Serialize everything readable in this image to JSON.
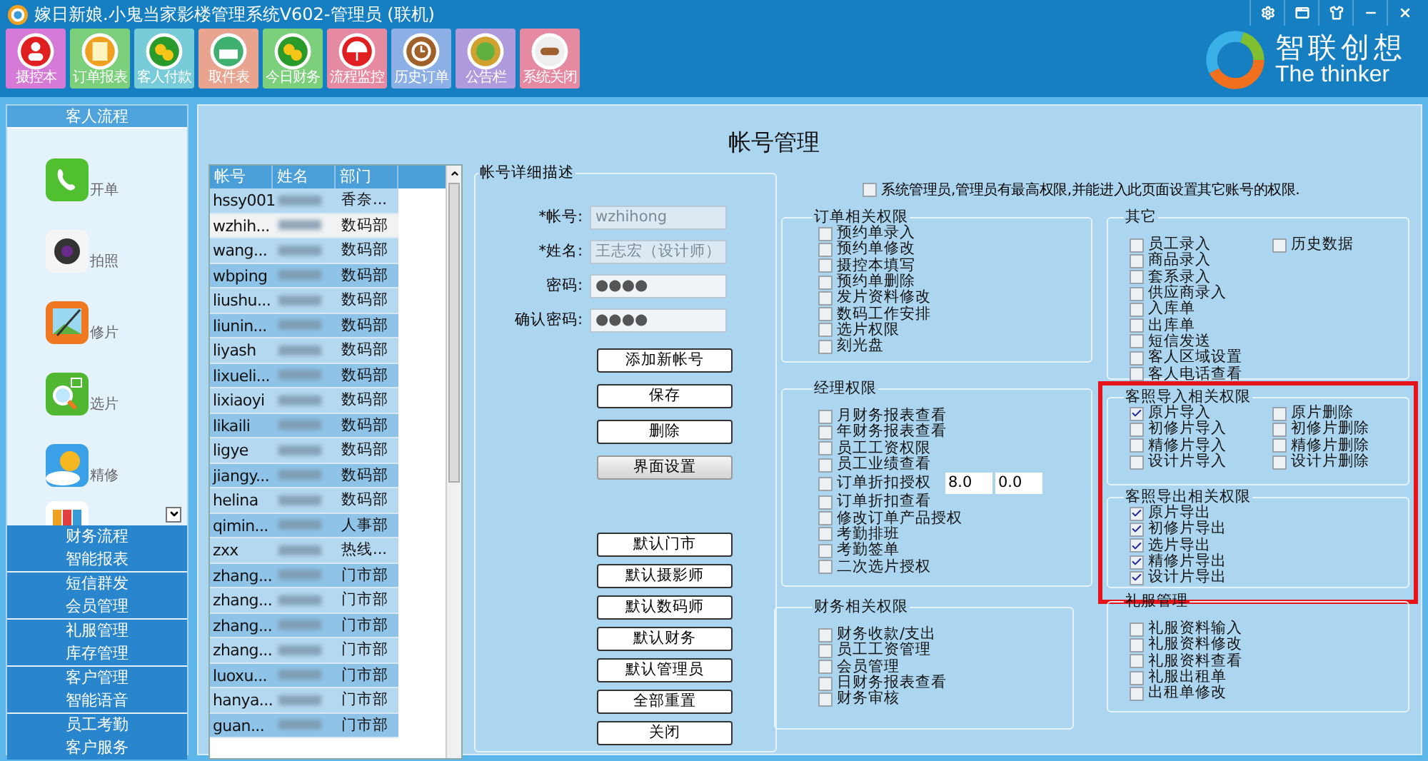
{
  "window": {
    "title": "嫁日新娘.小鬼当家影楼管理系统V602-管理员 (联机)"
  },
  "toolbar": [
    {
      "label": "摄控本",
      "color": "#d57ad6"
    },
    {
      "label": "订单报表",
      "color": "#7cd07c"
    },
    {
      "label": "客人付款",
      "color": "#78cbd8"
    },
    {
      "label": "取件表",
      "color": "#e9a48f"
    },
    {
      "label": "今日财务",
      "color": "#7cd07c"
    },
    {
      "label": "流程监控",
      "color": "#e68aa2"
    },
    {
      "label": "历史订单",
      "color": "#8cb0e6"
    },
    {
      "label": "公告栏",
      "color": "#b09ade"
    },
    {
      "label": "系统关闭",
      "color": "#e68aa2"
    }
  ],
  "logo": {
    "name": "智联创想",
    "tagline": "The thinker"
  },
  "sidebar": {
    "sections": [
      {
        "label": "客人流程",
        "expanded": true,
        "items": [
          "开单",
          "拍照",
          "修片",
          "选片",
          "精修"
        ]
      },
      {
        "label": "财务流程",
        "expanded": false
      },
      {
        "label": "智能报表",
        "expanded": false
      },
      {
        "label": "短信群发",
        "expanded": false
      },
      {
        "label": "会员管理",
        "expanded": false
      },
      {
        "label": "礼服管理",
        "expanded": false
      },
      {
        "label": "库存管理",
        "expanded": false
      },
      {
        "label": "客户管理",
        "expanded": false
      },
      {
        "label": "智能语音",
        "expanded": false
      },
      {
        "label": "员工考勤",
        "expanded": false
      },
      {
        "label": "客户服务",
        "expanded": false
      }
    ]
  },
  "page_title": "帐号管理",
  "accounts_table": {
    "columns": [
      "帐号",
      "姓名",
      "部门"
    ],
    "rows": [
      {
        "account": "hssy001",
        "department": "香奈...",
        "selected": false
      },
      {
        "account": "wzhih...",
        "department": "数码部",
        "selected": true
      },
      {
        "account": "wang...",
        "department": "数码部",
        "selected": false
      },
      {
        "account": "wbping",
        "department": "数码部",
        "selected": false
      },
      {
        "account": "liushu...",
        "department": "数码部",
        "selected": false
      },
      {
        "account": "liunin...",
        "department": "数码部",
        "selected": false
      },
      {
        "account": "liyash",
        "department": "数码部",
        "selected": false
      },
      {
        "account": "lixueli...",
        "department": "数码部",
        "selected": false
      },
      {
        "account": "lixiaoyi",
        "department": "数码部",
        "selected": false
      },
      {
        "account": "likaili",
        "department": "数码部",
        "selected": false
      },
      {
        "account": "ligye",
        "department": "数码部",
        "selected": false
      },
      {
        "account": "jiangy...",
        "department": "数码部",
        "selected": false
      },
      {
        "account": "helina",
        "department": "数码部",
        "selected": false
      },
      {
        "account": "qimin...",
        "department": "人事部",
        "selected": false
      },
      {
        "account": "zxx",
        "department": "热线...",
        "selected": false
      },
      {
        "account": "zhang...",
        "department": "门市部",
        "selected": false
      },
      {
        "account": "zhang...",
        "department": "门市部",
        "selected": false
      },
      {
        "account": "zhang...",
        "department": "门市部",
        "selected": false
      },
      {
        "account": "zhang...",
        "department": "门市部",
        "selected": false
      },
      {
        "account": "luoxu...",
        "department": "门市部",
        "selected": false
      },
      {
        "account": "hanya...",
        "department": "门市部",
        "selected": false
      },
      {
        "account": "guan...",
        "department": "门市部",
        "selected": false
      }
    ]
  },
  "account_details": {
    "title": "帐号详细描述",
    "fields": [
      {
        "label": "*帐号:",
        "value": "wzhihong",
        "kind": "text",
        "disabled": true
      },
      {
        "label": "*姓名:",
        "value": "王志宏（设计师）",
        "kind": "select",
        "disabled": true
      },
      {
        "label": "密码:",
        "value": "●●●●",
        "kind": "text",
        "disabled": false
      },
      {
        "label": "确认密码:",
        "value": "●●●●",
        "kind": "text",
        "disabled": false
      }
    ],
    "buttons": [
      {
        "label": "添加新帐号",
        "kind": "plain"
      },
      {
        "label": "保存",
        "kind": "plain"
      },
      {
        "label": "删除",
        "kind": "plain"
      },
      {
        "label": "界面设置",
        "kind": "shaded"
      }
    ],
    "default_buttons": [
      "默认门市",
      "默认摄影师",
      "默认数码师",
      "默认财务",
      "默认管理员",
      "全部重置",
      "关闭"
    ]
  },
  "system_admin": {
    "label": "系统管理员,管理员有最高权限,并能进入此页面设置其它账号的权限.",
    "checked": false
  },
  "left_groups": [
    {
      "title": "订单相关权限",
      "columns": [
        [
          {
            "label": "预约单录入",
            "checked": false
          },
          {
            "label": "预约单修改",
            "checked": false
          },
          {
            "label": "摄控本填写",
            "checked": false
          },
          {
            "label": "预约单删除",
            "checked": false
          },
          {
            "label": "发片资料修改",
            "checked": false
          },
          {
            "label": "数码工作安排",
            "checked": false
          },
          {
            "label": "选片权限",
            "checked": false
          },
          {
            "label": "刻光盘",
            "checked": false
          }
        ]
      ]
    },
    {
      "title": "经理权限",
      "discount_fields": [
        "8.0",
        "0.0"
      ],
      "columns": [
        [
          {
            "label": "月财务报表查看",
            "checked": false
          },
          {
            "label": "年财务报表查看",
            "checked": false
          },
          {
            "label": "员工工资权限",
            "checked": false
          },
          {
            "label": "员工业绩查看",
            "checked": false
          },
          {
            "label": "订单折扣授权",
            "checked": false
          },
          {
            "label": "订单折扣查看",
            "checked": false
          },
          {
            "label": "修改订单产品授权",
            "checked": false
          },
          {
            "label": "考勤排班",
            "checked": false
          },
          {
            "label": "考勤签单",
            "checked": false
          },
          {
            "label": "二次选片授权",
            "checked": false
          }
        ]
      ]
    },
    {
      "title": "财务相关权限",
      "columns": [
        [
          {
            "label": "财务收款/支出",
            "checked": false
          },
          {
            "label": "员工工资管理",
            "checked": false
          },
          {
            "label": "会员管理",
            "checked": false
          },
          {
            "label": "日财务报表查看",
            "checked": false
          },
          {
            "label": "财务审核",
            "checked": false
          }
        ]
      ]
    }
  ],
  "right_groups": [
    {
      "title": "其它",
      "columns": [
        [
          {
            "label": "员工录入",
            "checked": false
          },
          {
            "label": "商品录入",
            "checked": false
          },
          {
            "label": "套系录入",
            "checked": false
          },
          {
            "label": "供应商录入",
            "checked": false
          },
          {
            "label": "入库单",
            "checked": false
          },
          {
            "label": "出库单",
            "checked": false
          },
          {
            "label": "短信发送",
            "checked": false
          },
          {
            "label": "客人区域设置",
            "checked": false
          },
          {
            "label": "客人电话查看",
            "checked": false
          }
        ],
        [
          {
            "label": "历史数据",
            "checked": false
          }
        ]
      ]
    },
    {
      "title": "客照导入相关权限",
      "columns": [
        [
          {
            "label": "原片导入",
            "checked": true
          },
          {
            "label": "初修片导入",
            "checked": false
          },
          {
            "label": "精修片导入",
            "checked": false
          },
          {
            "label": "设计片导入",
            "checked": false
          }
        ],
        [
          {
            "label": "原片删除",
            "checked": false
          },
          {
            "label": "初修片删除",
            "checked": false
          },
          {
            "label": "精修片删除",
            "checked": false
          },
          {
            "label": "设计片删除",
            "checked": false
          }
        ]
      ]
    },
    {
      "title": "客照导出相关权限",
      "columns": [
        [
          {
            "label": "原片导出",
            "checked": true
          },
          {
            "label": "初修片导出",
            "checked": true
          },
          {
            "label": "选片导出",
            "checked": true
          },
          {
            "label": "精修片导出",
            "checked": true
          },
          {
            "label": "设计片导出",
            "checked": true
          }
        ]
      ]
    },
    {
      "title": "礼服管理",
      "columns": [
        [
          {
            "label": "礼服资料输入",
            "checked": false
          },
          {
            "label": "礼服资料修改",
            "checked": false
          },
          {
            "label": "礼服资料查看",
            "checked": false
          },
          {
            "label": "礼服出租单",
            "checked": false
          },
          {
            "label": "出租单修改",
            "checked": false
          }
        ]
      ]
    }
  ]
}
